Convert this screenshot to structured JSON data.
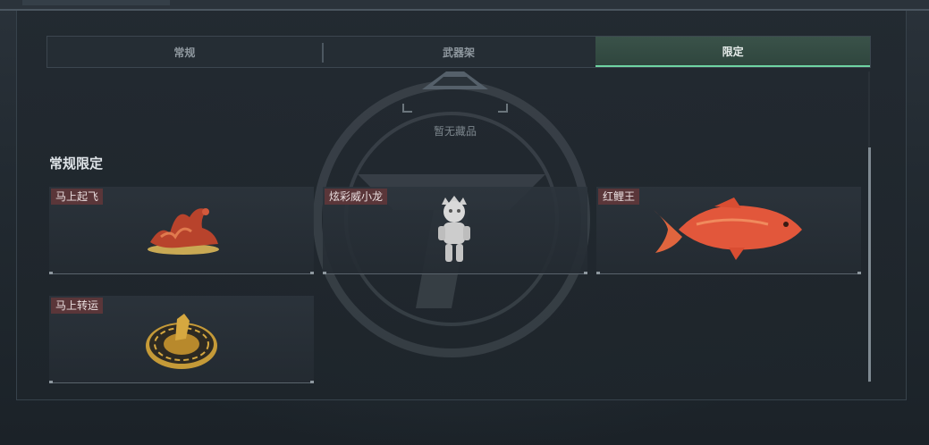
{
  "tabs": [
    {
      "label": "常规",
      "active": false
    },
    {
      "label": "武器架",
      "active": false
    },
    {
      "label": "限定",
      "active": true
    }
  ],
  "empty_state": {
    "text": "暂无藏品"
  },
  "section": {
    "title": "常规限定"
  },
  "items": [
    {
      "label": "马上起飞",
      "icon": "red-horse-figurine"
    },
    {
      "label": "炫彩威小龙",
      "icon": "white-dragon-figure"
    },
    {
      "label": "红鲤王",
      "icon": "red-carp-fish"
    },
    {
      "label": "马上转运",
      "icon": "golden-horse-compass"
    }
  ],
  "colors": {
    "accent": "#6fd4a3",
    "active_tab_bg": "#3a5249",
    "label_bg": "#5a3639",
    "panel_bg": "#222a31"
  }
}
